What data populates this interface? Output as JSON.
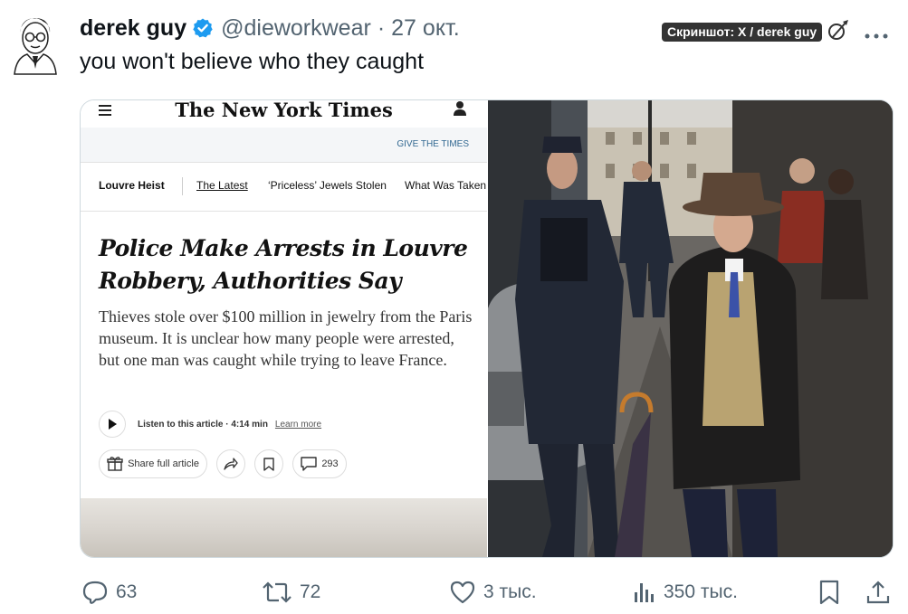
{
  "tweet": {
    "author_name": "derek guy",
    "handle": "@dieworkwear",
    "separator": "·",
    "date": "27 окт.",
    "text": "you won't believe who they caught",
    "screenshot_credit": "Скриншот: X / derek guy"
  },
  "nyt": {
    "logo": "The New York Times",
    "give_link": "GIVE THE TIMES",
    "nav": {
      "section": "Louvre Heist",
      "items": [
        "The Latest",
        "‘Priceless’ Jewels Stolen",
        "What Was Taken"
      ]
    },
    "headline": "Police Make Arrests in Louvre Robbery, Authorities Say",
    "summary": "Thieves stole over $100 million in jewelry from the Paris museum. It is unclear how many people were arrested, but one man was caught while trying to leave France.",
    "listen_label": "Listen to this article · 4:14 min",
    "learn_more": "Learn more",
    "share_label": "Share full article",
    "comments_count": "293"
  },
  "stats": {
    "replies": "63",
    "retweets": "72",
    "likes": "3 тыс.",
    "views": "350 тыс."
  },
  "colors": {
    "text_primary": "#0f1419",
    "text_secondary": "#536471",
    "verified_blue": "#1d9bf0",
    "nyt_link": "#326891"
  },
  "icons": [
    "verified-badge-icon",
    "edit-icon",
    "more-icon",
    "hamburger-icon",
    "account-icon",
    "play-icon",
    "gift-icon",
    "share-arrow-icon",
    "bookmark-icon",
    "comment-icon",
    "reply-icon",
    "retweet-icon",
    "like-icon",
    "views-icon",
    "share-icon"
  ]
}
